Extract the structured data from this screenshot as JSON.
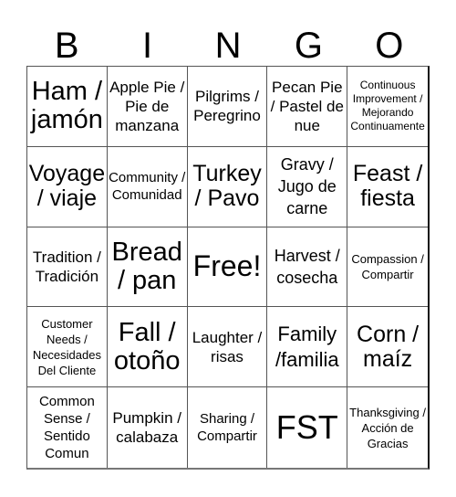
{
  "title_letters": [
    "B",
    "I",
    "N",
    "G",
    "O"
  ],
  "cells": [
    [
      "Ham / jamón",
      "Apple Pie / Pie de manzana",
      "Pilgrims / Peregrino",
      "Pecan Pie / Pastel de nue",
      "Continuous Improvement / Mejorando Continuamente"
    ],
    [
      "Voyage / viaje",
      "Community / Comunidad",
      "Turkey / Pavo",
      "Gravy / Jugo de carne",
      "Feast / fiesta"
    ],
    [
      "Tradition / Tradición",
      "Bread / pan",
      "Free!",
      "Harvest / cosecha",
      "Compassion / Compartir"
    ],
    [
      "Customer Needs / Necesidades Del Cliente",
      "Fall / otoño",
      "Laughter / risas",
      "Family /familia",
      "Corn / maíz"
    ],
    [
      "Common Sense / Sentido Comun",
      "Pumpkin / calabaza",
      "Sharing / Compartir",
      "FST",
      "Thanksgiving / Acción de Gracias"
    ]
  ]
}
